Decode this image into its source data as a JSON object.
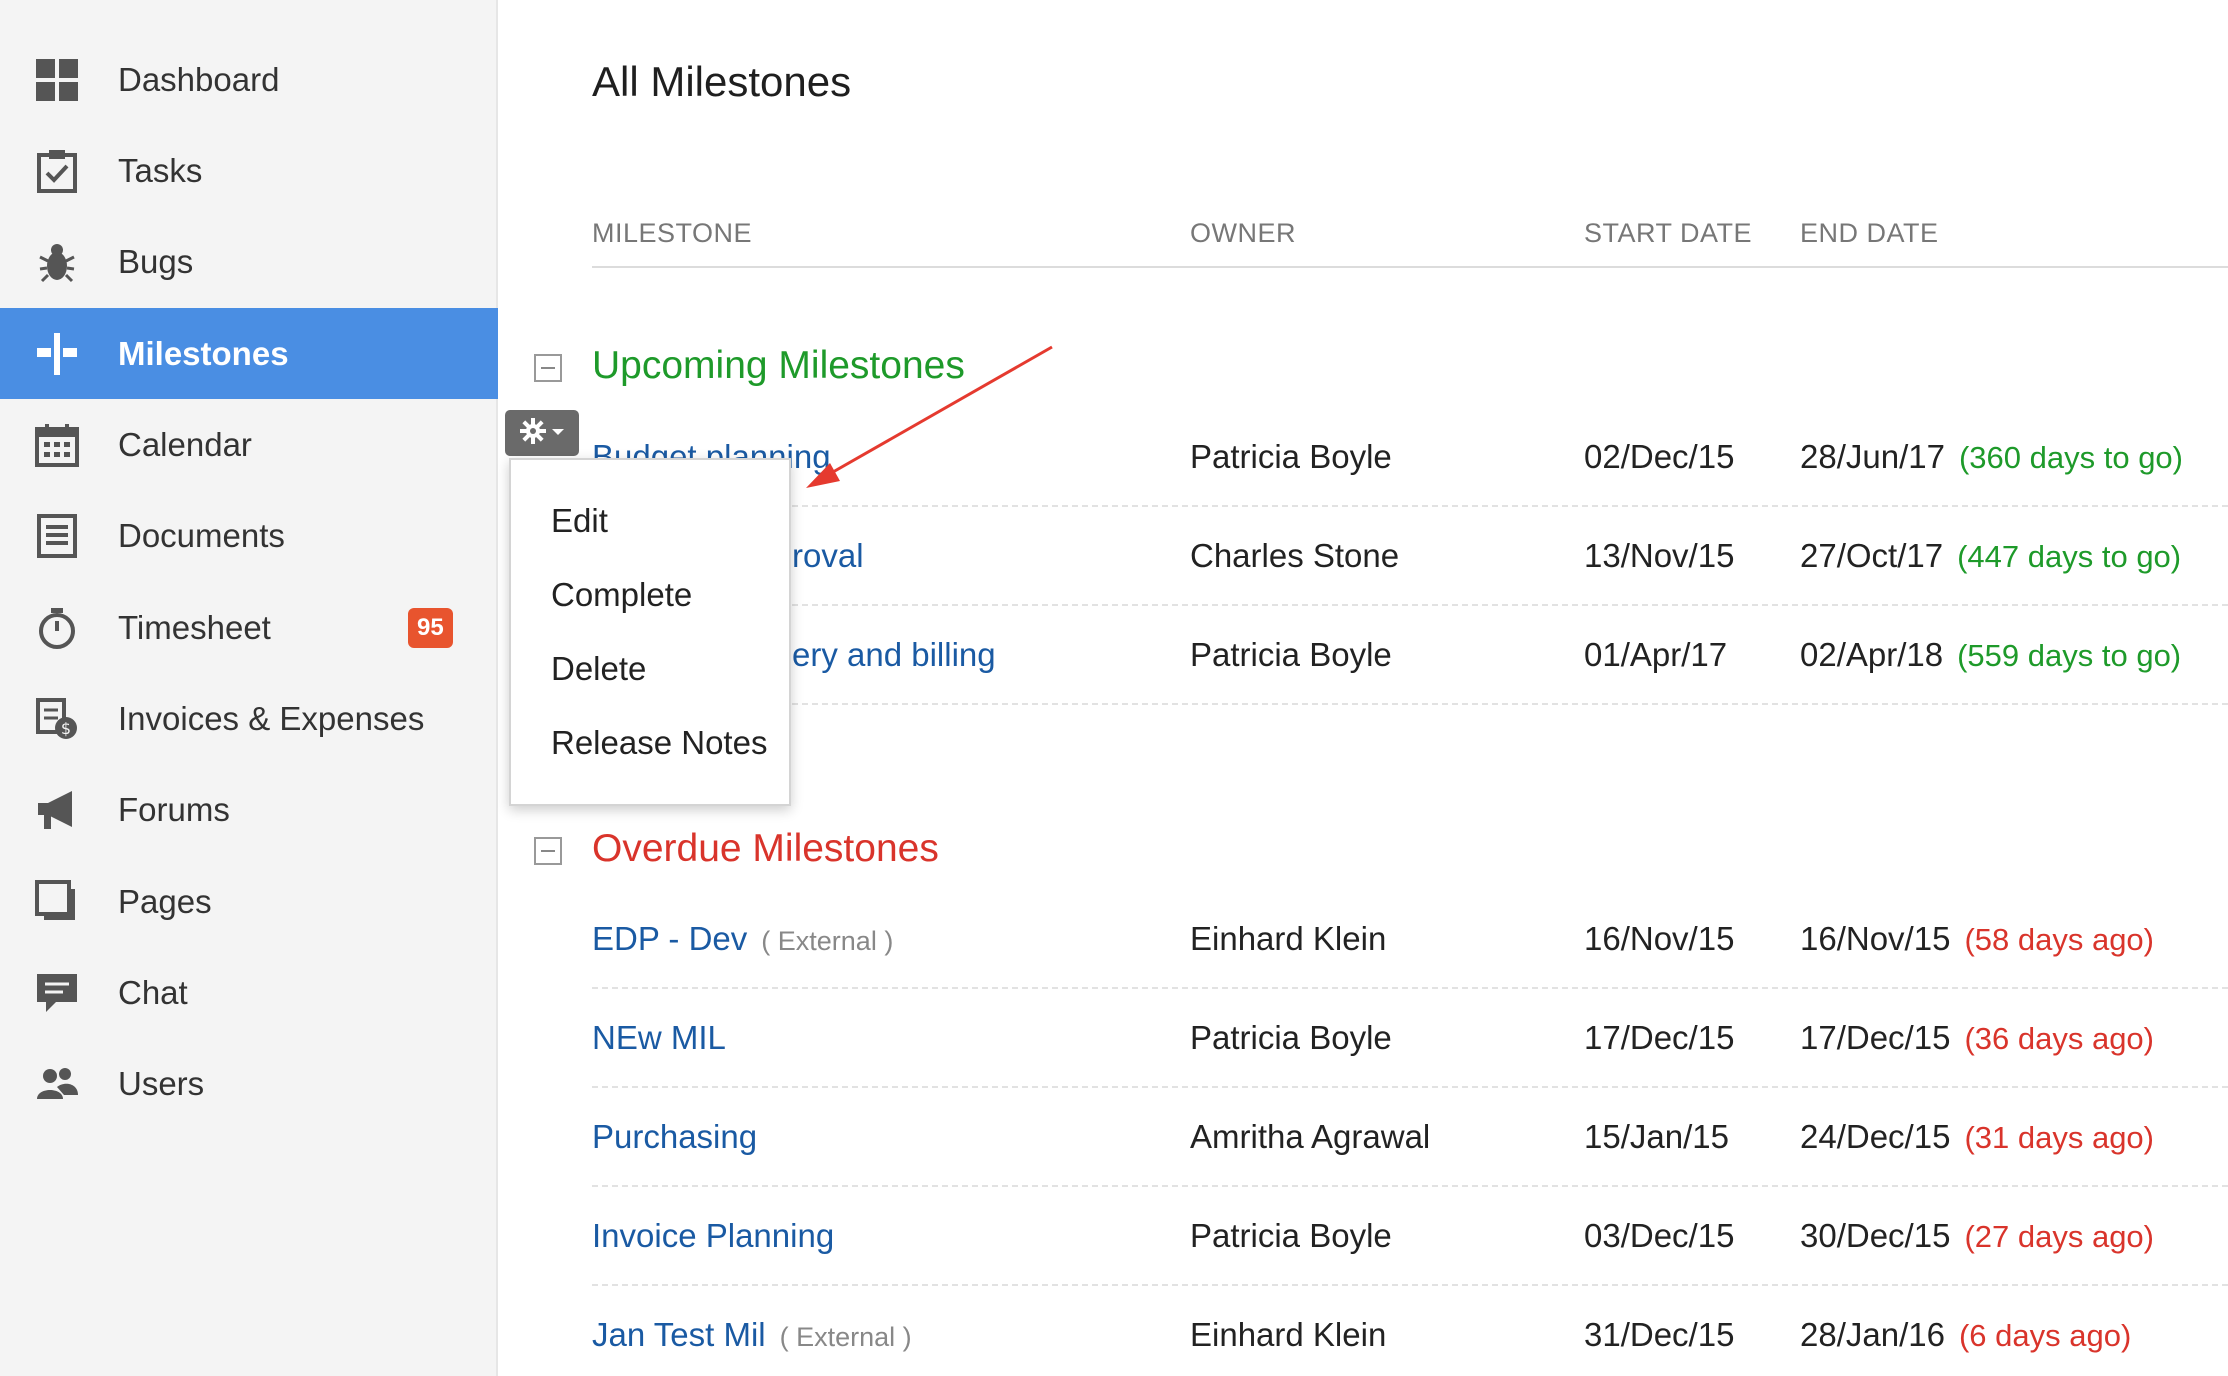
{
  "sidebar": {
    "items": [
      {
        "label": "Dashboard",
        "icon": "grid-icon"
      },
      {
        "label": "Tasks",
        "icon": "task-checkbox-icon"
      },
      {
        "label": "Bugs",
        "icon": "bug-icon"
      },
      {
        "label": "Milestones",
        "icon": "milestone-icon",
        "active": true
      },
      {
        "label": "Calendar",
        "icon": "calendar-icon"
      },
      {
        "label": "Documents",
        "icon": "document-icon"
      },
      {
        "label": "Timesheet",
        "icon": "stopwatch-icon",
        "badge": "95"
      },
      {
        "label": "Invoices & Expenses",
        "icon": "invoice-icon"
      },
      {
        "label": "Forums",
        "icon": "megaphone-icon"
      },
      {
        "label": "Pages",
        "icon": "pages-icon"
      },
      {
        "label": "Chat",
        "icon": "chat-icon"
      },
      {
        "label": "Users",
        "icon": "users-icon"
      }
    ]
  },
  "main": {
    "title": "All Milestones",
    "columns": [
      "MILESTONE",
      "OWNER",
      "START DATE",
      "END DATE"
    ],
    "upcoming": {
      "title": "Upcoming Milestones",
      "rows": [
        {
          "name": "Budget planning",
          "owner": "Patricia Boyle",
          "start": "02/Dec/15",
          "end": "28/Jun/17",
          "relative": "(360 days to go)"
        },
        {
          "name": "roval",
          "owner": "Charles Stone",
          "start": "13/Nov/15",
          "end": "27/Oct/17",
          "relative": "(447 days to go)"
        },
        {
          "name": "ery and billing",
          "owner": "Patricia Boyle",
          "start": "01/Apr/17",
          "end": "02/Apr/18",
          "relative": "(559 days to go)"
        }
      ]
    },
    "overdue": {
      "title": "Overdue Milestones",
      "rows": [
        {
          "name": "EDP - Dev",
          "tag": "( External )",
          "owner": "Einhard Klein",
          "start": "16/Nov/15",
          "end": "16/Nov/15",
          "relative": "(58 days ago)"
        },
        {
          "name": "NEw MIL",
          "tag": "",
          "owner": "Patricia Boyle",
          "start": "17/Dec/15",
          "end": "17/Dec/15",
          "relative": "(36 days ago)"
        },
        {
          "name": "Purchasing",
          "tag": "",
          "owner": "Amritha Agrawal",
          "start": "15/Jan/15",
          "end": "24/Dec/15",
          "relative": "(31 days ago)"
        },
        {
          "name": "Invoice Planning",
          "tag": "",
          "owner": "Patricia Boyle",
          "start": "03/Dec/15",
          "end": "30/Dec/15",
          "relative": "(27 days ago)"
        },
        {
          "name": "Jan Test Mil",
          "tag": "( External )",
          "owner": "Einhard Klein",
          "start": "31/Dec/15",
          "end": "28/Jan/16",
          "relative": "(6 days ago)"
        }
      ]
    }
  },
  "menu": {
    "items": [
      "Edit",
      "Complete",
      "Delete",
      "Release Notes"
    ]
  },
  "colors": {
    "accent": "#4a8ee3",
    "link": "#1a5aa3",
    "upcoming": "#1e9a2a",
    "overdue": "#d9342b",
    "badge": "#e8542e",
    "annotation_arrow": "#e53a2f"
  }
}
